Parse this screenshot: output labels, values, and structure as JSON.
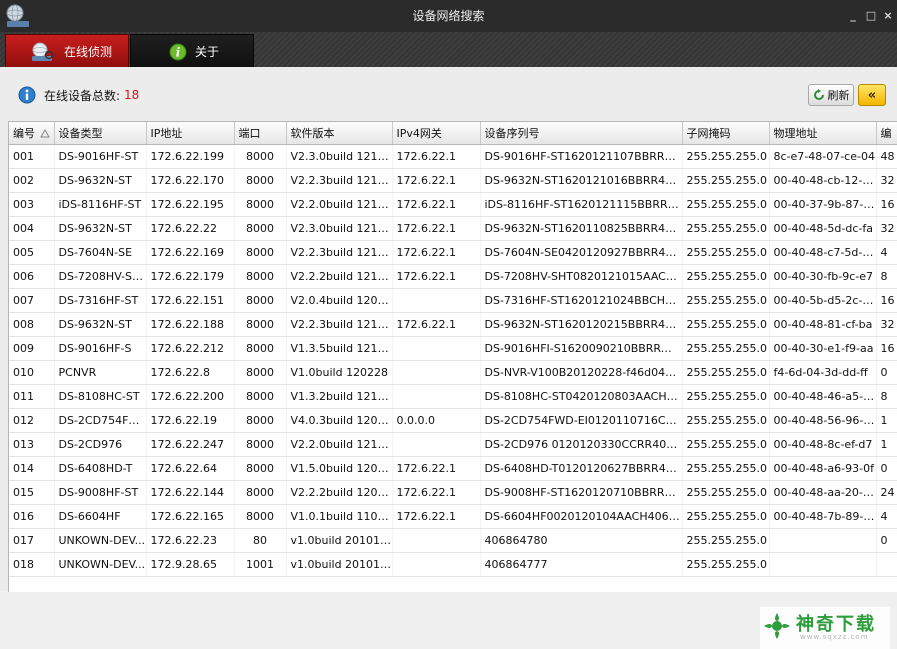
{
  "window": {
    "title": "设备网络搜索",
    "controls": [
      "_",
      "□",
      "×"
    ]
  },
  "tabs": [
    {
      "label": "在线侦测",
      "icon": "search-globe-icon",
      "active": true
    },
    {
      "label": "关于",
      "icon": "info-icon",
      "active": false
    }
  ],
  "summary": {
    "label": "在线设备总数:",
    "count": "18"
  },
  "toolbar": {
    "refresh_label": "刷新",
    "back_label": "«"
  },
  "table": {
    "headers": [
      "编号",
      "设备类型",
      "IP地址",
      "端口",
      "软件版本",
      "IPv4网关",
      "设备序列号",
      "子网掩码",
      "物理地址",
      "编"
    ],
    "rows": [
      [
        "001",
        "DS-9016HF-ST",
        "172.6.22.199",
        "8000",
        "V2.3.0build 121211",
        "172.6.22.1",
        "DS-9016HF-ST1620121107BBRR412...",
        "255.255.255.0",
        "8c-e7-48-07-ce-04",
        "48"
      ],
      [
        "002",
        "DS-9632N-ST",
        "172.6.22.170",
        "8000",
        "V2.2.3build 121212",
        "172.6.22.1",
        "DS-9632N-ST1620121016BBRR4117...",
        "255.255.255.0",
        "00-40-48-cb-12-8a",
        "32"
      ],
      [
        "003",
        "iDS-8116HF-ST",
        "172.6.22.195",
        "8000",
        "V2.2.0build 121214",
        "172.6.22.1",
        "iDS-8116HF-ST1620121115BBRR123...",
        "255.255.255.0",
        "00-40-37-9b-87-e5",
        "16"
      ],
      [
        "004",
        "DS-9632N-ST",
        "172.6.22.22",
        "8000",
        "V2.3.0build 121211",
        "172.6.22.1",
        "DS-9632N-ST1620110825BBRR4046...",
        "255.255.255.0",
        "00-40-48-5d-dc-fa",
        "32"
      ],
      [
        "005",
        "DS-7604N-SE",
        "172.6.22.169",
        "8000",
        "V2.2.3build 121212",
        "172.6.22.1",
        "DS-7604N-SE0420120927BBRR4115...",
        "255.255.255.0",
        "00-40-48-c7-5d-4d",
        "4"
      ],
      [
        "006",
        "DS-7208HV-SHT",
        "172.6.22.179",
        "8000",
        "V2.2.2build 121219",
        "172.6.22.1",
        "DS-7208HV-SHT0820121015AACH01...",
        "255.255.255.0",
        "00-40-30-fb-9c-e7",
        "8"
      ],
      [
        "007",
        "DS-7316HF-ST",
        "172.6.22.151",
        "8000",
        "V2.0.4build 120725",
        "",
        "DS-7316HF-ST1620121024BBCH731...",
        "255.255.255.0",
        "00-40-5b-d5-2c-48",
        "16"
      ],
      [
        "008",
        "DS-9632N-ST",
        "172.6.22.188",
        "8000",
        "V2.2.3build 121207",
        "172.6.22.1",
        "DS-9632N-ST1620120215BBRR4069...",
        "255.255.255.0",
        "00-40-48-81-cf-ba",
        "32"
      ],
      [
        "009",
        "DS-9016HF-S",
        "172.6.22.212",
        "8000",
        "V1.3.5build 121220",
        "",
        "DS-9016HFI-S1620090210BBRRWCVU",
        "255.255.255.0",
        "00-40-30-e1-f9-aa",
        "16"
      ],
      [
        "010",
        "PCNVR",
        "172.6.22.8",
        "8000",
        "V1.0build 120228",
        "",
        "DS-NVR-V100B20120228-f46d043dddff",
        "255.255.255.0",
        "f4-6d-04-3d-dd-ff",
        "0"
      ],
      [
        "011",
        "DS-8108HC-ST",
        "172.6.22.200",
        "8000",
        "V1.3.2build 121109",
        "",
        "DS-8108HC-ST0420120803AACH000...",
        "255.255.255.0",
        "00-40-48-46-a5-5b",
        "8"
      ],
      [
        "012",
        "DS-2CD754FW...",
        "172.6.22.19",
        "8000",
        "V4.0.3build 120815",
        "0.0.0.0",
        "DS-2CD754FWD-EI0120110716CCR...",
        "255.255.255.0",
        "00-40-48-56-96-76",
        "1"
      ],
      [
        "013",
        "DS-2CD976",
        "172.6.22.247",
        "8000",
        "V2.2.0build 121216",
        "",
        "DS-2CD976 0120120330CCRR40771...",
        "255.255.255.0",
        "00-40-48-8c-ef-d7",
        "1"
      ],
      [
        "014",
        "DS-6408HD-T",
        "172.6.22.64",
        "8000",
        "V1.5.0build 120601",
        "172.6.22.1",
        "DS-6408HD-T0120120627BBRR4093...",
        "255.255.255.0",
        "00-40-48-a6-93-0f",
        "0"
      ],
      [
        "015",
        "DS-9008HF-ST",
        "172.6.22.144",
        "8000",
        "V2.2.2build 120924",
        "172.6.22.1",
        "DS-9008HF-ST1620120710BBRR409...",
        "255.255.255.0",
        "00-40-48-aa-20-7a",
        "24"
      ],
      [
        "016",
        "DS-6604HF",
        "172.6.22.165",
        "8000",
        "V1.0.1build 110906",
        "172.6.22.1",
        "DS-6604HF0020120104AACH406572...",
        "255.255.255.0",
        "00-40-48-7b-89-33",
        "4"
      ],
      [
        "017",
        "UNKOWN-DEV...",
        "172.6.22.23",
        "80",
        "v1.0build 20101009",
        "",
        "406864780",
        "255.255.255.0",
        "",
        "0"
      ],
      [
        "018",
        "UNKOWN-DEV...",
        "172.9.28.65",
        "1001",
        "v1.0build 20101009",
        "",
        "406864777",
        "255.255.255.0",
        "",
        ""
      ]
    ]
  },
  "watermark": {
    "text": "神奇下载",
    "url": "www.sqxzz.com"
  },
  "colors": {
    "active_tab": "#c81e1e",
    "count_text": "#d21616",
    "watermark_green": "#2e9e3c"
  }
}
